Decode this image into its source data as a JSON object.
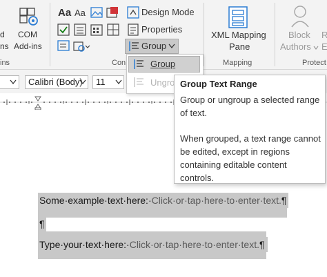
{
  "ribbon": {
    "addins_left_label_1": "d",
    "addins_left_label_2": "ns",
    "com_addins_label_1": "COM",
    "com_addins_label_2": "Add-ins",
    "addins_group_label": "ins",
    "design_mode_label": "Design Mode",
    "properties_label": "Properties",
    "group_label": "Group",
    "controls_group_label": "Con",
    "xml_mapping_label_1": "XML Mapping",
    "xml_mapping_label_2": "Pane",
    "mapping_group_label": "Mapping",
    "block_authors_label_1": "Block",
    "block_authors_label_2": "Authors",
    "protect_label_1": "R",
    "protect_label_2": "E",
    "protect_group_label": "Protect"
  },
  "fontbar": {
    "font_name": "Calibri (Body)",
    "font_size": "11"
  },
  "menu": {
    "group_item": "Group",
    "ungroup_item": "Ungro"
  },
  "tooltip": {
    "title": "Group Text Range",
    "line1": "Group or ungroup a selected range",
    "line2": "of text.",
    "line3": "When grouped, a text range cannot",
    "line4": "be edited, except in regions",
    "line5": "containing editable content",
    "line6": "controls."
  },
  "document": {
    "line1_text": "Some·example·text·here:·",
    "line1_placeholder": "Click·or·tap·here·to·enter·text.",
    "line1_mark": "¶",
    "line2_mark": "¶",
    "line3_text": "Type·your·text·here:·",
    "line3_placeholder": "Click·or·tap·here·to·enter·text.",
    "line3_mark": "¶"
  },
  "icons": [
    "com-addins-icon",
    "text-content-control-icon",
    "checkbox-control-icon",
    "picture-control-icon",
    "design-mode-icon",
    "properties-icon",
    "group-icon",
    "xml-mapping-icon",
    "block-authors-icon"
  ]
}
